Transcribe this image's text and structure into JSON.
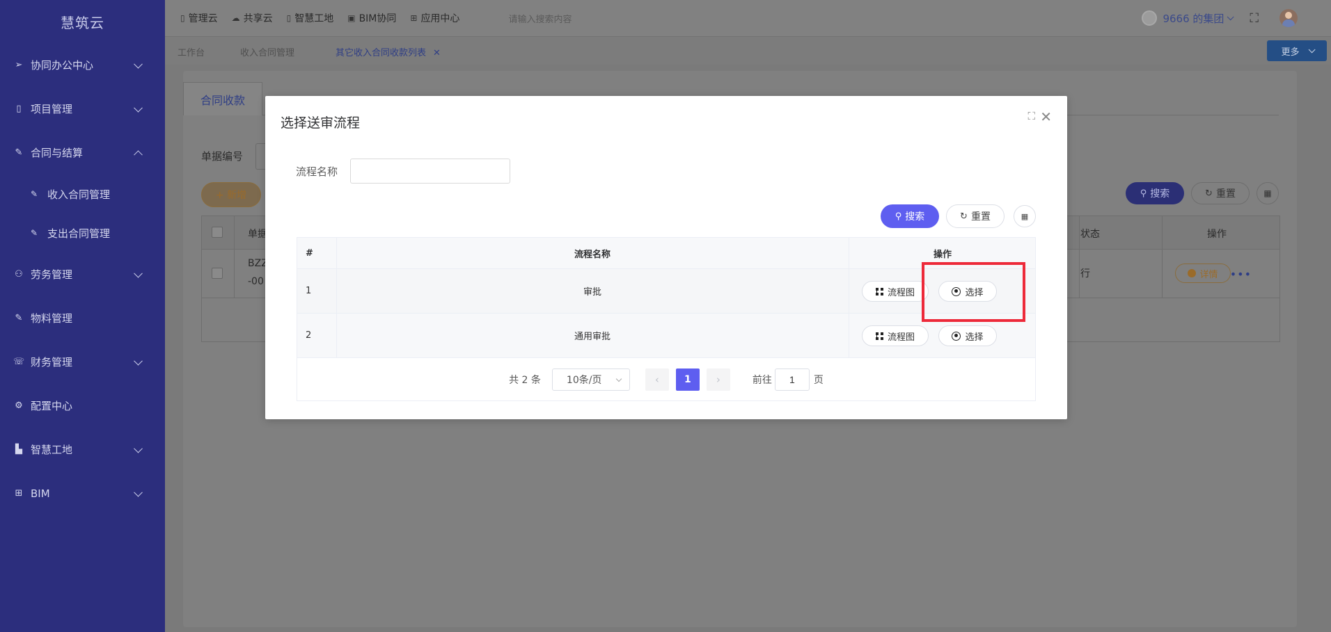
{
  "sidebar": {
    "logo": "慧筑云",
    "items": [
      {
        "label": "协同办公中心",
        "icon": "send-icon",
        "expanded": false
      },
      {
        "label": "项目管理",
        "icon": "book-icon",
        "expanded": false
      },
      {
        "label": "合同与结算",
        "icon": "edit-icon",
        "expanded": true,
        "children": [
          {
            "label": "收入合同管理",
            "icon": "edit-icon"
          },
          {
            "label": "支出合同管理",
            "icon": "edit-icon"
          }
        ]
      },
      {
        "label": "劳务管理",
        "icon": "users-icon",
        "expanded": false
      },
      {
        "label": "物料管理",
        "icon": "edit-icon"
      },
      {
        "label": "财务管理",
        "icon": "phone-icon",
        "expanded": false
      },
      {
        "label": "配置中心",
        "icon": "gear-icon"
      },
      {
        "label": "智慧工地",
        "icon": "bar-chart-icon",
        "expanded": false
      },
      {
        "label": "BIM",
        "icon": "grid-icon",
        "expanded": false
      }
    ]
  },
  "topbar": {
    "nav": [
      {
        "label": "管理云",
        "icon": "book-icon"
      },
      {
        "label": "共享云",
        "icon": "cloud-icon"
      },
      {
        "label": "智慧工地",
        "icon": "book-icon"
      },
      {
        "label": "BIM协同",
        "icon": "folder-icon"
      },
      {
        "label": "应用中心",
        "icon": "grid-icon"
      }
    ],
    "search_placeholder": "请输入搜索内容",
    "group_name": "9666 的集团"
  },
  "tabs": [
    {
      "label": "工作台"
    },
    {
      "label": "收入合同管理"
    },
    {
      "label": "其它收入合同收款列表",
      "active": true
    }
  ],
  "more_label": "更多",
  "background_page": {
    "card_tab": "合同收款",
    "filter_label": "单据编号",
    "add_label": "+ 新增",
    "search_label": "搜索",
    "reset_label": "重置",
    "table": {
      "headers": {
        "doc": "单据",
        "status": "状态",
        "ops": "操作"
      },
      "row": {
        "doc_line1": "BZZ",
        "doc_line2": "-00",
        "status_char": "行",
        "detail_label": "详情"
      }
    }
  },
  "modal": {
    "title": "选择送审流程",
    "field_label": "流程名称",
    "field_value": "",
    "search_label": "搜索",
    "reset_label": "重置",
    "table": {
      "headers": {
        "index": "#",
        "name": "流程名称",
        "ops": "操作"
      },
      "rows": [
        {
          "index": "1",
          "name": "审批",
          "flow_label": "流程图",
          "select_label": "选择"
        },
        {
          "index": "2",
          "name": "通用审批",
          "flow_label": "流程图",
          "select_label": "选择"
        }
      ]
    },
    "pagination": {
      "total": "共 2 条",
      "page_size": "10条/页",
      "current_page": "1",
      "goto_prefix": "前往",
      "goto_value": "1",
      "goto_suffix": "页"
    }
  },
  "colors": {
    "sidebar_bg": "#2c2e7d",
    "primary": "#5e5ef0",
    "highlight": "#ed2a3a"
  }
}
